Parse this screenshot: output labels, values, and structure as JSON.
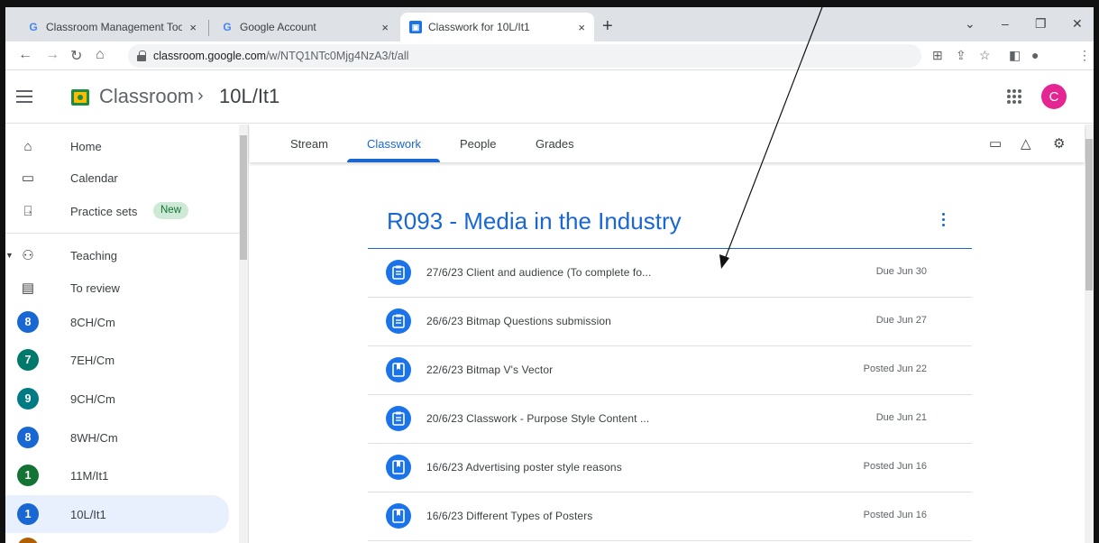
{
  "browser": {
    "tabs": [
      {
        "label": "Classroom Management Tools &",
        "icon": "google-g-icon"
      },
      {
        "label": "Google Account",
        "icon": "google-g-icon"
      },
      {
        "label": "Classwork for 10L/It1",
        "icon": "classroom-icon"
      }
    ],
    "close_glyph": "×",
    "new_tab_glyph": "+",
    "url_host": "classroom.google.com",
    "url_path": "/w/NTQ1NTc0Mjg4NzA3/t/all"
  },
  "header": {
    "app_title": "Classroom",
    "separator": "›",
    "course_name": "10L/It1",
    "avatar_letter": "C",
    "avatar_color": "#e52592"
  },
  "sidebar": {
    "nav": [
      {
        "label": "Home",
        "icon": "home-icon"
      },
      {
        "label": "Calendar",
        "icon": "calendar-icon"
      },
      {
        "label": "Practice sets",
        "icon": "practice-sets-icon",
        "badge": "New"
      }
    ],
    "teaching_label": "Teaching",
    "to_review_label": "To review",
    "classes": [
      {
        "letter": "8",
        "label": "8CH/Cm",
        "color": "#1967d2"
      },
      {
        "letter": "7",
        "label": "7EH/Cm",
        "color": "#00796b"
      },
      {
        "letter": "9",
        "label": "9CH/Cm",
        "color": "#007b83"
      },
      {
        "letter": "8",
        "label": "8WH/Cm",
        "color": "#1967d2"
      },
      {
        "letter": "1",
        "label": "11M/It1",
        "color": "#137333"
      },
      {
        "letter": "1",
        "label": "10L/It1",
        "color": "#1967d2",
        "selected": true
      }
    ]
  },
  "main": {
    "tabs": [
      "Stream",
      "Classwork",
      "People",
      "Grades"
    ],
    "active_tab": "Classwork",
    "topic_title": "R093 - Media in the Industry",
    "items": [
      {
        "title": "27/6/23 Client and audience (To complete fo...",
        "status": "Due Jun 30",
        "type": "assignment"
      },
      {
        "title": "26/6/23 Bitmap Questions submission",
        "status": "Due Jun 27",
        "type": "assignment"
      },
      {
        "title": "22/6/23 Bitmap V's Vector",
        "status": "Posted Jun 22",
        "type": "material"
      },
      {
        "title": "20/6/23 Classwork - Purpose Style Content ...",
        "status": "Due Jun 21",
        "type": "assignment"
      },
      {
        "title": "16/6/23 Advertising poster style reasons",
        "status": "Posted Jun 16",
        "type": "material"
      },
      {
        "title": "16/6/23 Different Types of Posters",
        "status": "Posted Jun 16",
        "type": "material"
      }
    ]
  },
  "colors": {
    "accent": "#1967d2",
    "item_icon": "#1a73e8",
    "selected_bg": "#e8f0fe",
    "badge_bg": "#ceead6"
  }
}
